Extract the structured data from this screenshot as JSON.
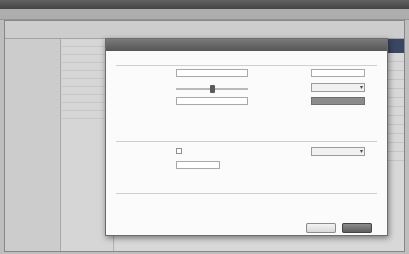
{
  "app": {
    "title": ""
  },
  "sidebar": {
    "header": "",
    "items": [
      {
        "label": ""
      },
      {
        "label": ""
      },
      {
        "label": ""
      },
      {
        "label": ""
      },
      {
        "label": ""
      },
      {
        "label": ""
      },
      {
        "label": ""
      },
      {
        "label": ""
      },
      {
        "label": ""
      },
      {
        "label": ""
      },
      {
        "label": ""
      },
      {
        "label": ""
      },
      {
        "label": ""
      },
      {
        "label": ""
      },
      {
        "label": ""
      },
      {
        "label": ""
      },
      {
        "label": ""
      },
      {
        "label": ""
      }
    ]
  },
  "dialog": {
    "title": "",
    "sections": [
      {
        "label": ""
      },
      {
        "label": ""
      },
      {
        "label": ""
      }
    ],
    "fields": [
      {
        "label": "",
        "value": ""
      },
      {
        "label": "",
        "value": ""
      },
      {
        "label": "",
        "value": ""
      },
      {
        "label": "",
        "value": ""
      },
      {
        "label": "",
        "value": ""
      },
      {
        "label": "",
        "value": ""
      },
      {
        "label": "",
        "value": ""
      },
      {
        "label": "",
        "value": ""
      }
    ],
    "dropdown": {
      "selected": ""
    },
    "buttons": {
      "cancel": "",
      "ok": ""
    }
  },
  "colors": {
    "titlebar": "#555555",
    "dialog_title": "#666666",
    "content_header": "#3f4e6e",
    "primary_button": "#6f6f6f"
  },
  "icons": [
    "chevron-down-icon",
    "checkbox-icon"
  ]
}
